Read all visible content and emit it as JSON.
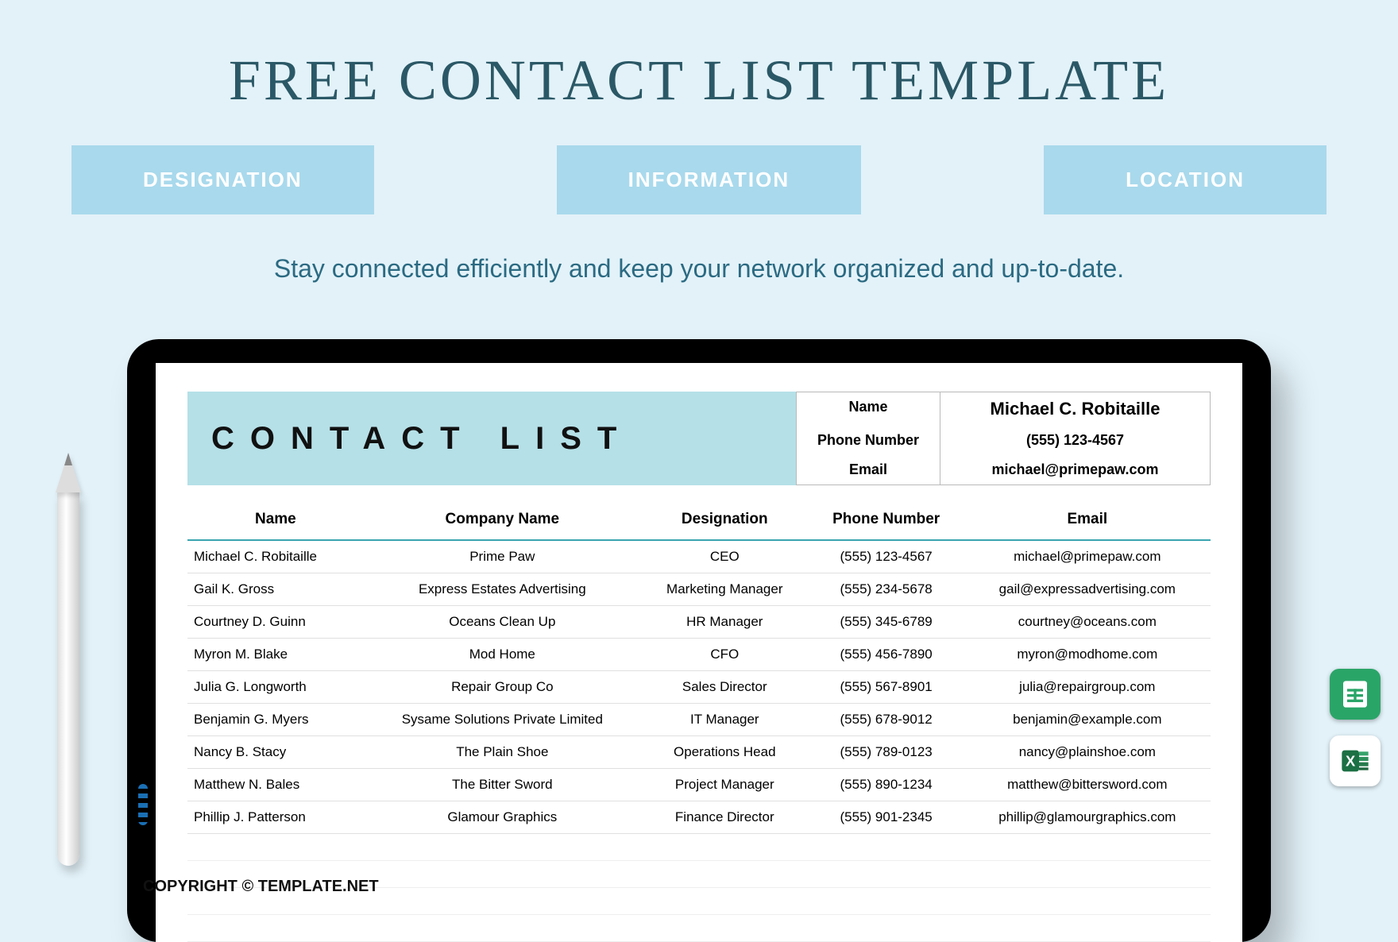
{
  "header": {
    "title": "FREE CONTACT LIST TEMPLATE",
    "tagline": "Stay connected efficiently and keep your network organized and up-to-date."
  },
  "chips": [
    "DESIGNATION",
    "INFORMATION",
    "LOCATION"
  ],
  "doc": {
    "title": "CONTACT LIST",
    "owner_labels": {
      "name": "Name",
      "phone": "Phone Number",
      "email": "Email"
    },
    "owner": {
      "name": "Michael C. Robitaille",
      "phone": "(555) 123-4567",
      "email": "michael@primepaw.com"
    },
    "columns": [
      "Name",
      "Company Name",
      "Designation",
      "Phone Number",
      "Email"
    ],
    "rows": [
      {
        "name": "Michael C. Robitaille",
        "company": "Prime Paw",
        "designation": "CEO",
        "phone": "(555) 123-4567",
        "email": "michael@primepaw.com"
      },
      {
        "name": "Gail K. Gross",
        "company": "Express Estates Advertising",
        "designation": "Marketing Manager",
        "phone": "(555) 234-5678",
        "email": "gail@expressadvertising.com"
      },
      {
        "name": "Courtney D. Guinn",
        "company": "Oceans Clean Up",
        "designation": "HR Manager",
        "phone": "(555) 345-6789",
        "email": "courtney@oceans.com"
      },
      {
        "name": "Myron M. Blake",
        "company": "Mod Home",
        "designation": "CFO",
        "phone": "(555) 456-7890",
        "email": "myron@modhome.com"
      },
      {
        "name": "Julia G. Longworth",
        "company": "Repair Group Co",
        "designation": "Sales Director",
        "phone": "(555) 567-8901",
        "email": "julia@repairgroup.com"
      },
      {
        "name": "Benjamin G. Myers",
        "company": "Sysame Solutions Private Limited",
        "designation": "IT Manager",
        "phone": "(555) 678-9012",
        "email": "benjamin@example.com"
      },
      {
        "name": "Nancy B. Stacy",
        "company": "The Plain Shoe",
        "designation": "Operations Head",
        "phone": "(555) 789-0123",
        "email": "nancy@plainshoe.com"
      },
      {
        "name": "Matthew N. Bales",
        "company": "The Bitter Sword",
        "designation": "Project Manager",
        "phone": "(555) 890-1234",
        "email": "matthew@bittersword.com"
      },
      {
        "name": "Phillip J. Patterson",
        "company": "Glamour Graphics",
        "designation": "Finance Director",
        "phone": "(555) 901-2345",
        "email": "phillip@glamourgraphics.com"
      }
    ],
    "empty_rows": 4
  },
  "copyright": "COPYRIGHT © TEMPLATE.NET"
}
